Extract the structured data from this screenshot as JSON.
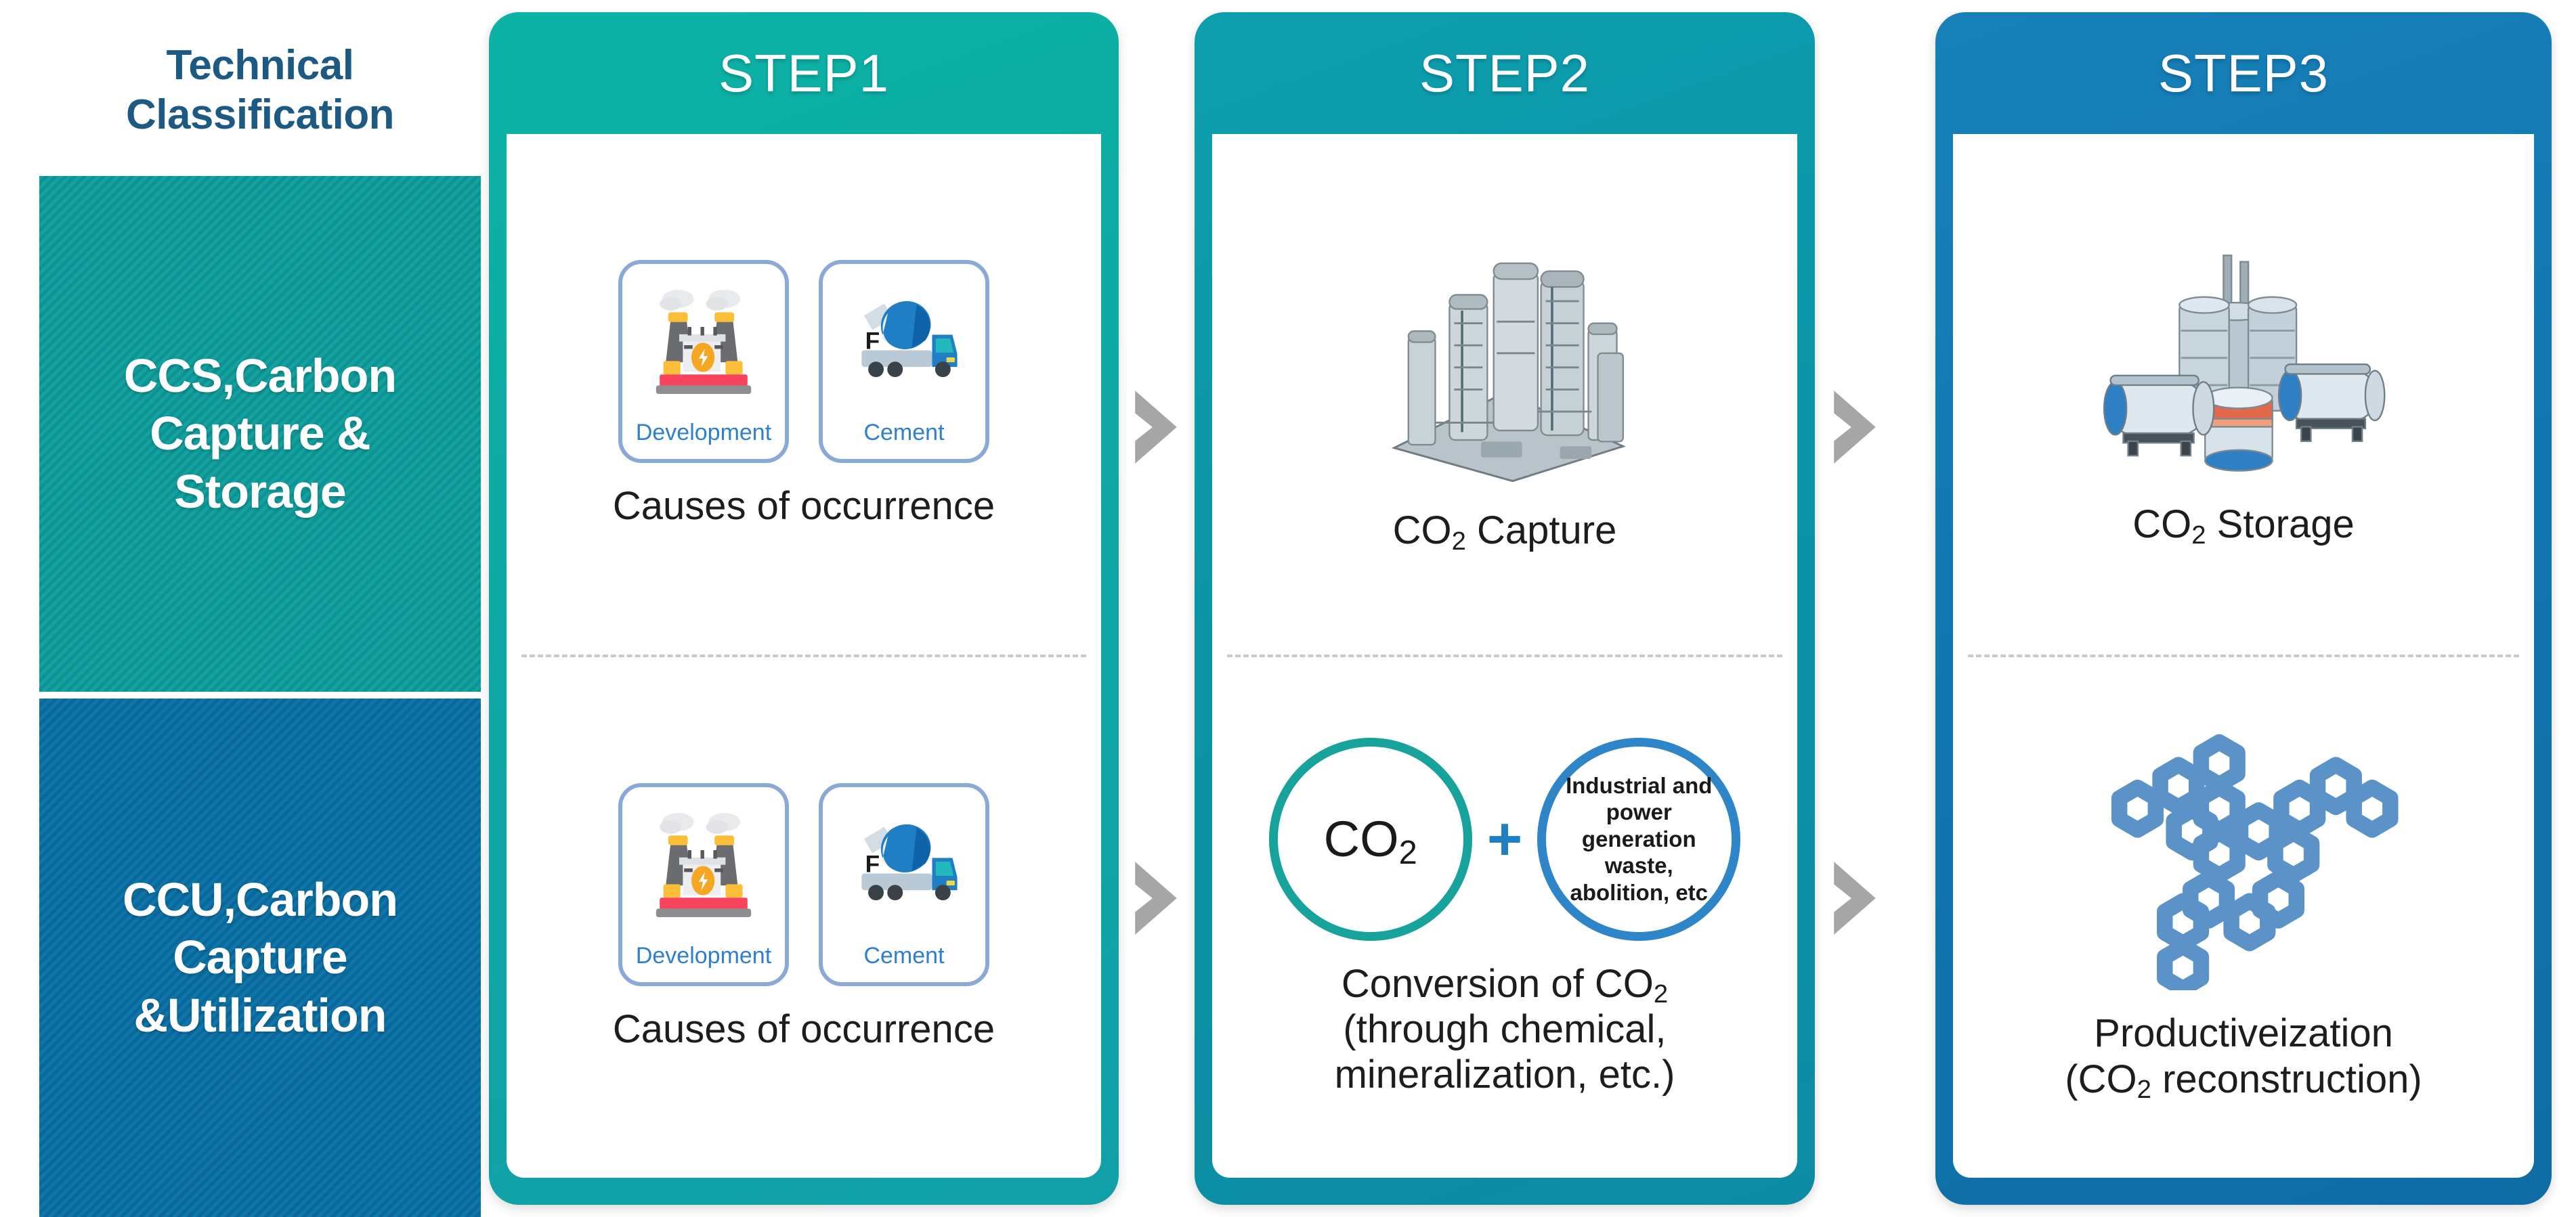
{
  "classification": {
    "title_line1": "Technical",
    "title_line2": "Classification",
    "blocks": [
      {
        "id": "ccs",
        "line1": "CCS,Carbon",
        "line2": "Capture &",
        "line3": "Storage",
        "color": "#13a39e"
      },
      {
        "id": "ccu",
        "line1": "CCU,Carbon",
        "line2": "Capture",
        "line3": "&Utilization",
        "color": "#0e76ab"
      }
    ]
  },
  "steps": [
    {
      "id": "step1",
      "header": "STEP1",
      "header_color": "#0fa8a4",
      "top": {
        "tiles": [
          {
            "label": "Development",
            "icon": "power-plant-icon"
          },
          {
            "label": "Cement",
            "icon": "cement-mixer-truck-icon"
          }
        ],
        "caption": "Causes of occurrence"
      },
      "bottom": {
        "tiles": [
          {
            "label": "Development",
            "icon": "power-plant-icon"
          },
          {
            "label": "Cement",
            "icon": "cement-mixer-truck-icon"
          }
        ],
        "caption": "Causes of occurrence"
      }
    },
    {
      "id": "step2",
      "header": "STEP2",
      "header_color": "#0b93a7",
      "top": {
        "icon": "industrial-plant-icon",
        "caption_pre": "CO",
        "caption_sub": "2",
        "caption_post": " Capture"
      },
      "bottom": {
        "circle_left": "CO",
        "circle_left_sub": "2",
        "plus": "+",
        "circle_right": "Industrial and power generation waste, abolition, etc",
        "caption_line1_pre": "Conversion of CO",
        "caption_line1_sub": "2",
        "caption_line2": "(through chemical,",
        "caption_line3": "mineralization, etc.)"
      }
    },
    {
      "id": "step3",
      "header": "STEP3",
      "header_color": "#1276ae",
      "top": {
        "icon": "storage-tanks-icon",
        "caption_pre": "CO",
        "caption_sub": "2",
        "caption_post": " Storage"
      },
      "bottom": {
        "icon": "molecule-lattice-icon",
        "caption_line1": "Productiveization",
        "caption_line2_pre": "(CO",
        "caption_line2_sub": "2",
        "caption_line2_post": " reconstruction)"
      }
    }
  ],
  "arrows": {
    "glyph": "chevron-right",
    "color": "#a6a6a6",
    "count": 4
  },
  "colors": {
    "teal": "#13a39e",
    "blue": "#0e76ab",
    "step1_header": "#0fa8a4",
    "step2_header": "#0b93a7",
    "step3_header": "#1276ae",
    "tile_border": "#8aa9d6",
    "tile_label": "#2f7fd0",
    "title_text": "#1c5a84",
    "arrow": "#a6a6a6"
  }
}
